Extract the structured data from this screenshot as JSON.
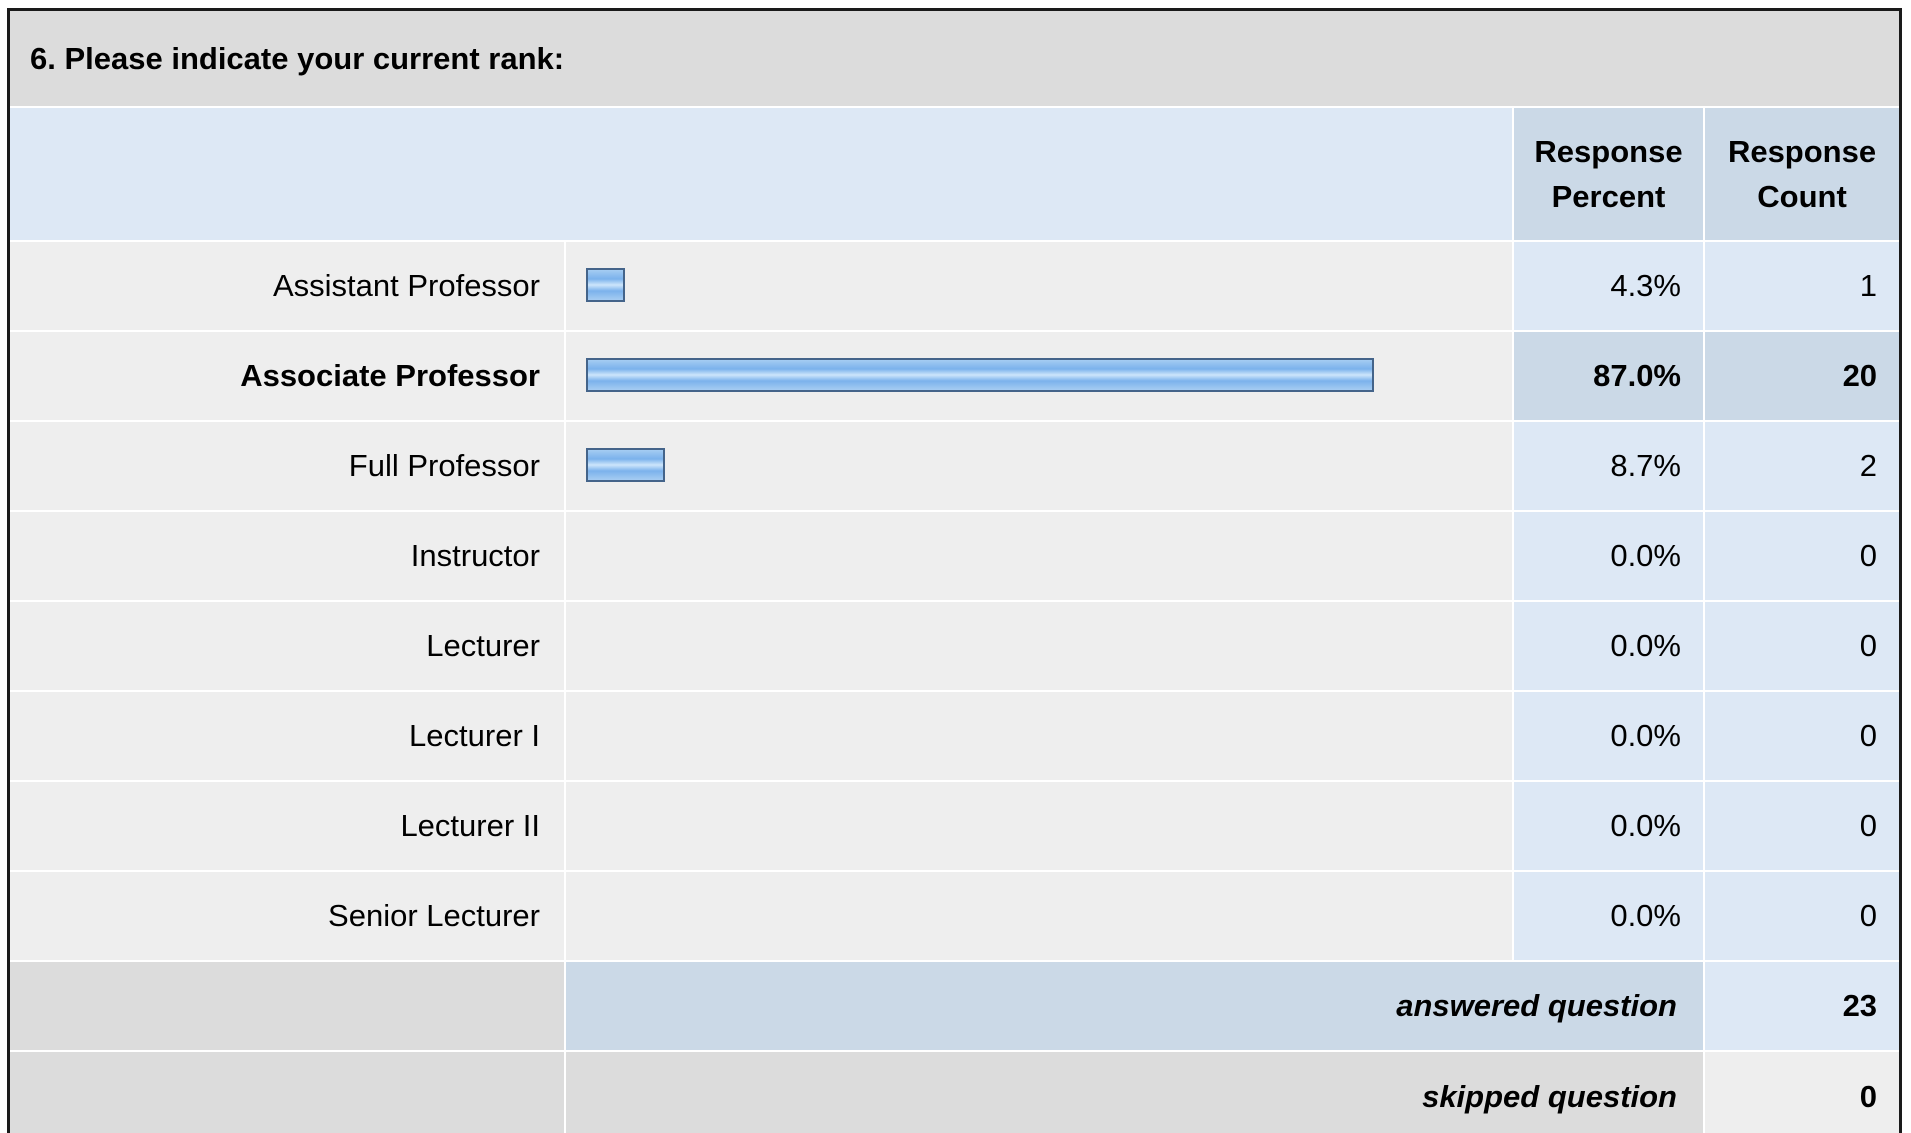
{
  "question": {
    "title": "6. Please indicate your current rank:"
  },
  "header": {
    "percent_line1": "Response",
    "percent_line2": "Percent",
    "count_line1": "Response",
    "count_line2": "Count"
  },
  "chart_data": {
    "type": "bar",
    "orientation": "horizontal",
    "title": "6. Please indicate your current rank:",
    "categories": [
      "Assistant Professor",
      "Associate Professor",
      "Full Professor",
      "Instructor",
      "Lecturer",
      "Lecturer I",
      "Lecturer II",
      "Senior Lecturer"
    ],
    "series": [
      {
        "values": [
          4.3,
          87.0,
          8.7,
          0.0,
          0.0,
          0.0,
          0.0,
          0.0
        ]
      }
    ],
    "xlim": [
      0,
      100
    ],
    "grid": false,
    "rows": [
      {
        "label": "Assistant Professor",
        "percent": 4.3,
        "percent_text": "4.3%",
        "count": 1,
        "count_text": "1",
        "highlight": false
      },
      {
        "label": "Associate Professor",
        "percent": 87.0,
        "percent_text": "87.0%",
        "count": 20,
        "count_text": "20",
        "highlight": true
      },
      {
        "label": "Full Professor",
        "percent": 8.7,
        "percent_text": "8.7%",
        "count": 2,
        "count_text": "2",
        "highlight": false
      },
      {
        "label": "Instructor",
        "percent": 0.0,
        "percent_text": "0.0%",
        "count": 0,
        "count_text": "0",
        "highlight": false
      },
      {
        "label": "Lecturer",
        "percent": 0.0,
        "percent_text": "0.0%",
        "count": 0,
        "count_text": "0",
        "highlight": false
      },
      {
        "label": "Lecturer I",
        "percent": 0.0,
        "percent_text": "0.0%",
        "count": 0,
        "count_text": "0",
        "highlight": false
      },
      {
        "label": "Lecturer II",
        "percent": 0.0,
        "percent_text": "0.0%",
        "count": 0,
        "count_text": "0",
        "highlight": false
      },
      {
        "label": "Senior Lecturer",
        "percent": 0.0,
        "percent_text": "0.0%",
        "count": 0,
        "count_text": "0",
        "highlight": false
      }
    ],
    "answered_label": "answered question",
    "answered_count": "23",
    "skipped_label": "skipped question",
    "skipped_count": "0"
  },
  "colors": {
    "bar_fill": "#7bb2ec",
    "bar_border": "#44648a",
    "header_bg": "#cbd9e7",
    "row_bg": "#eeeeee",
    "value_bg": "#dde8f5",
    "title_bg": "#dcdcdc"
  }
}
